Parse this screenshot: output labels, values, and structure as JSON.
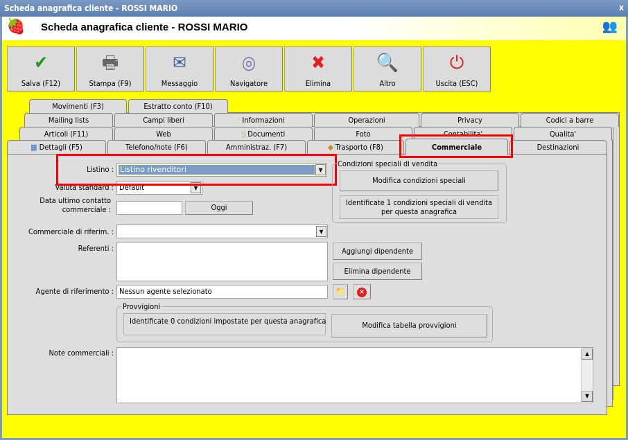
{
  "window": {
    "title": "Scheda anagrafica cliente - ROSSI MARIO",
    "close": "x"
  },
  "header": {
    "title": "Scheda anagrafica cliente - ROSSI MARIO"
  },
  "toolbar": [
    {
      "label": "Salva (F12)",
      "icon": "✔",
      "color": "#1a9a1a"
    },
    {
      "label": "Stampa (F9)",
      "icon": "🖶",
      "color": "#666666"
    },
    {
      "label": "Messaggio",
      "icon": "✉",
      "color": "#4060a0"
    },
    {
      "label": "Navigatore",
      "icon": "◎",
      "color": "#7070b0"
    },
    {
      "label": "Elimina",
      "icon": "✖",
      "color": "#e02020"
    },
    {
      "label": "Altro",
      "icon": "🔍",
      "color": "#2060c0"
    },
    {
      "label": "Uscita (ESC)",
      "icon": "⏻",
      "color": "#e02020"
    }
  ],
  "tabs": {
    "row1": [
      "Movimenti (F3)",
      "Estratto conto (F10)"
    ],
    "row2": [
      "Mailing lists",
      "Campi liberi",
      "Informazioni",
      "Operazioni",
      "Privacy",
      "Codici a barre"
    ],
    "row3": [
      "Articoli (F11)",
      "Web",
      "Documenti",
      "Foto",
      "Contabilita'",
      "Qualita'"
    ],
    "row4": [
      "Dettagli (F5)",
      "Telefono/note (F6)",
      "Amministraz. (F7)",
      "Trasporto (F8)",
      "Commerciale",
      "Destinazioni"
    ],
    "active": "Commerciale"
  },
  "form": {
    "listino_label": "Listino :",
    "listino_value": "Listino rivenditori",
    "valuta_label": "Valuta standard :",
    "valuta_value": "Default",
    "data_label_1": "Data ultimo contatto",
    "data_label_2": "commerciale :",
    "data_value": "",
    "oggi": "Oggi",
    "commerciale_label": "Commerciale di riferim. :",
    "commerciale_value": "",
    "referenti_label": "Referenti :",
    "aggiungi": "Aggiungi dipendente",
    "elimina": "Elimina dipendente",
    "agente_label": "Agente di riferimento :",
    "agente_value": "Nessun agente selezionato",
    "provvigioni_title": "Provvigioni",
    "provvigioni_info": "Identificate 0 condizioni impostate per questa anagrafica",
    "provvigioni_button": "Modifica tabella provvigioni",
    "note_label": "Note commerciali :",
    "note_value": "",
    "condizioni_title": "Condizioni speciali di vendita",
    "condizioni_button": "Modifica condizioni speciali",
    "condizioni_info": "Identificate 1 condizioni speciali di vendita per questa anagrafica"
  },
  "colors": {
    "background": "#ffff00",
    "highlight": "#ff0000",
    "selection": "#7b9cc4"
  }
}
